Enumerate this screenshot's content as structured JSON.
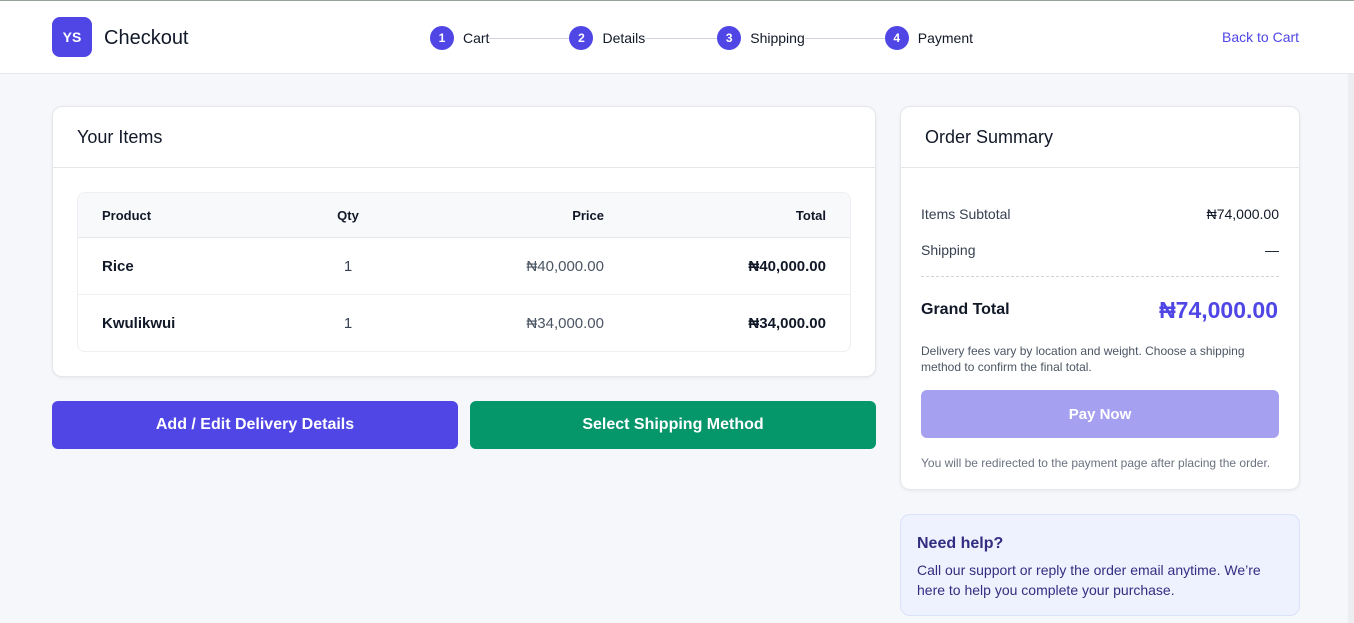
{
  "header": {
    "logo_text": "YS",
    "title": "Checkout",
    "back_link": "Back to Cart",
    "steps": [
      {
        "num": "1",
        "label": "Cart"
      },
      {
        "num": "2",
        "label": "Details"
      },
      {
        "num": "3",
        "label": "Shipping"
      },
      {
        "num": "4",
        "label": "Payment"
      }
    ]
  },
  "items": {
    "title": "Your Items",
    "columns": {
      "product": "Product",
      "qty": "Qty",
      "price": "Price",
      "total": "Total"
    },
    "rows": [
      {
        "product": "Rice",
        "qty": "1",
        "price": "₦40,000.00",
        "total": "₦40,000.00"
      },
      {
        "product": "Kwulikwui",
        "qty": "1",
        "price": "₦34,000.00",
        "total": "₦34,000.00"
      }
    ]
  },
  "actions": {
    "delivery_label": "Add / Edit Delivery Details",
    "shipping_label": "Select Shipping Method"
  },
  "summary": {
    "title": "Order Summary",
    "subtotal_label": "Items Subtotal",
    "subtotal_value": "₦74,000.00",
    "shipping_label": "Shipping",
    "shipping_value": "—",
    "grand_label": "Grand Total",
    "grand_value": "₦74,000.00",
    "note": "Delivery fees vary by location and weight. Choose a shipping method to confirm the final total.",
    "pay_label": "Pay Now",
    "redirect_note": "You will be redirected to the payment page after placing the order."
  },
  "help": {
    "title": "Need help?",
    "text": "Call our support or reply the order email anytime. We’re here to help you complete your purchase."
  },
  "colors": {
    "accent": "#4f46e5",
    "success": "#059669",
    "pay_disabled": "#a5a1f0"
  }
}
